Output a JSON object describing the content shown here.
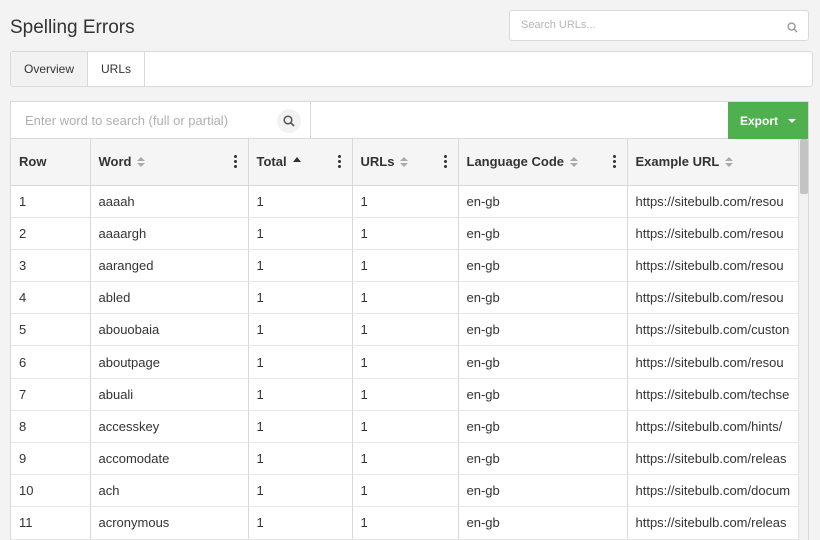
{
  "page": {
    "title": "Spelling Errors"
  },
  "search": {
    "placeholder": "Search URLs..."
  },
  "tabs": [
    {
      "label": "Overview",
      "active": true
    },
    {
      "label": "URLs",
      "active": false
    }
  ],
  "toolbar": {
    "word_search_placeholder": "Enter word to search (full or partial)",
    "export_label": "Export"
  },
  "table": {
    "columns": [
      {
        "label": "Row"
      },
      {
        "label": "Word"
      },
      {
        "label": "Total"
      },
      {
        "label": "URLs"
      },
      {
        "label": "Language Code"
      },
      {
        "label": "Example URL"
      }
    ],
    "rows": [
      [
        "1",
        "aaaah",
        "1",
        "1",
        "en-gb",
        "https://sitebulb.com/resou"
      ],
      [
        "2",
        "aaaargh",
        "1",
        "1",
        "en-gb",
        "https://sitebulb.com/resou"
      ],
      [
        "3",
        "aaranged",
        "1",
        "1",
        "en-gb",
        "https://sitebulb.com/resou"
      ],
      [
        "4",
        "abled",
        "1",
        "1",
        "en-gb",
        "https://sitebulb.com/resou"
      ],
      [
        "5",
        "abouobaia",
        "1",
        "1",
        "en-gb",
        "https://sitebulb.com/custon"
      ],
      [
        "6",
        "aboutpage",
        "1",
        "1",
        "en-gb",
        "https://sitebulb.com/resou"
      ],
      [
        "7",
        "abuali",
        "1",
        "1",
        "en-gb",
        "https://sitebulb.com/techse"
      ],
      [
        "8",
        "accesskey",
        "1",
        "1",
        "en-gb",
        "https://sitebulb.com/hints/"
      ],
      [
        "9",
        "accomodate",
        "1",
        "1",
        "en-gb",
        "https://sitebulb.com/releas"
      ],
      [
        "10",
        "ach",
        "1",
        "1",
        "en-gb",
        "https://sitebulb.com/docum"
      ],
      [
        "11",
        "acronymous",
        "1",
        "1",
        "en-gb",
        "https://sitebulb.com/releas"
      ]
    ]
  },
  "colors": {
    "accent": "#4fb04f",
    "header_bg": "#f5f5f5",
    "border": "#d9d9d9"
  },
  "icons": {
    "search": "search-icon",
    "sort": "sort-icon",
    "menu": "kebab-menu-icon",
    "caret": "caret-down-icon"
  }
}
